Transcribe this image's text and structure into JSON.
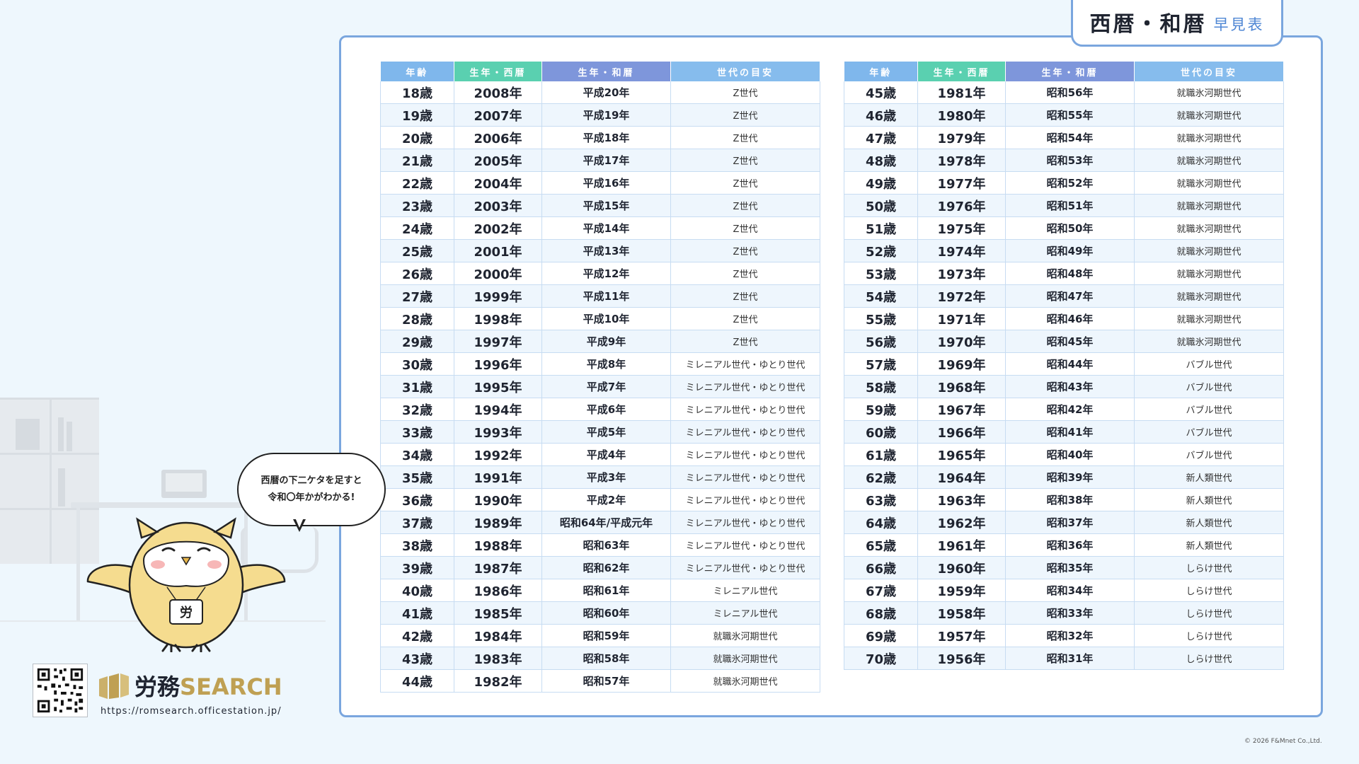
{
  "title": {
    "main": "西暦・和暦",
    "sub": "早見表"
  },
  "headers": [
    "年齢",
    "生年・西暦",
    "生年・和暦",
    "世代の目安"
  ],
  "left_rows": [
    [
      "18歳",
      "2008年",
      "平成20年",
      "Z世代"
    ],
    [
      "19歳",
      "2007年",
      "平成19年",
      "Z世代"
    ],
    [
      "20歳",
      "2006年",
      "平成18年",
      "Z世代"
    ],
    [
      "21歳",
      "2005年",
      "平成17年",
      "Z世代"
    ],
    [
      "22歳",
      "2004年",
      "平成16年",
      "Z世代"
    ],
    [
      "23歳",
      "2003年",
      "平成15年",
      "Z世代"
    ],
    [
      "24歳",
      "2002年",
      "平成14年",
      "Z世代"
    ],
    [
      "25歳",
      "2001年",
      "平成13年",
      "Z世代"
    ],
    [
      "26歳",
      "2000年",
      "平成12年",
      "Z世代"
    ],
    [
      "27歳",
      "1999年",
      "平成11年",
      "Z世代"
    ],
    [
      "28歳",
      "1998年",
      "平成10年",
      "Z世代"
    ],
    [
      "29歳",
      "1997年",
      "平成9年",
      "Z世代"
    ],
    [
      "30歳",
      "1996年",
      "平成8年",
      "ミレニアル世代・ゆとり世代"
    ],
    [
      "31歳",
      "1995年",
      "平成7年",
      "ミレニアル世代・ゆとり世代"
    ],
    [
      "32歳",
      "1994年",
      "平成6年",
      "ミレニアル世代・ゆとり世代"
    ],
    [
      "33歳",
      "1993年",
      "平成5年",
      "ミレニアル世代・ゆとり世代"
    ],
    [
      "34歳",
      "1992年",
      "平成4年",
      "ミレニアル世代・ゆとり世代"
    ],
    [
      "35歳",
      "1991年",
      "平成3年",
      "ミレニアル世代・ゆとり世代"
    ],
    [
      "36歳",
      "1990年",
      "平成2年",
      "ミレニアル世代・ゆとり世代"
    ],
    [
      "37歳",
      "1989年",
      "昭和64年/平成元年",
      "ミレニアル世代・ゆとり世代"
    ],
    [
      "38歳",
      "1988年",
      "昭和63年",
      "ミレニアル世代・ゆとり世代"
    ],
    [
      "39歳",
      "1987年",
      "昭和62年",
      "ミレニアル世代・ゆとり世代"
    ],
    [
      "40歳",
      "1986年",
      "昭和61年",
      "ミレニアル世代"
    ],
    [
      "41歳",
      "1985年",
      "昭和60年",
      "ミレニアル世代"
    ],
    [
      "42歳",
      "1984年",
      "昭和59年",
      "就職氷河期世代"
    ],
    [
      "43歳",
      "1983年",
      "昭和58年",
      "就職氷河期世代"
    ],
    [
      "44歳",
      "1982年",
      "昭和57年",
      "就職氷河期世代"
    ]
  ],
  "right_rows": [
    [
      "45歳",
      "1981年",
      "昭和56年",
      "就職氷河期世代"
    ],
    [
      "46歳",
      "1980年",
      "昭和55年",
      "就職氷河期世代"
    ],
    [
      "47歳",
      "1979年",
      "昭和54年",
      "就職氷河期世代"
    ],
    [
      "48歳",
      "1978年",
      "昭和53年",
      "就職氷河期世代"
    ],
    [
      "49歳",
      "1977年",
      "昭和52年",
      "就職氷河期世代"
    ],
    [
      "50歳",
      "1976年",
      "昭和51年",
      "就職氷河期世代"
    ],
    [
      "51歳",
      "1975年",
      "昭和50年",
      "就職氷河期世代"
    ],
    [
      "52歳",
      "1974年",
      "昭和49年",
      "就職氷河期世代"
    ],
    [
      "53歳",
      "1973年",
      "昭和48年",
      "就職氷河期世代"
    ],
    [
      "54歳",
      "1972年",
      "昭和47年",
      "就職氷河期世代"
    ],
    [
      "55歳",
      "1971年",
      "昭和46年",
      "就職氷河期世代"
    ],
    [
      "56歳",
      "1970年",
      "昭和45年",
      "就職氷河期世代"
    ],
    [
      "57歳",
      "1969年",
      "昭和44年",
      "バブル世代"
    ],
    [
      "58歳",
      "1968年",
      "昭和43年",
      "バブル世代"
    ],
    [
      "59歳",
      "1967年",
      "昭和42年",
      "バブル世代"
    ],
    [
      "60歳",
      "1966年",
      "昭和41年",
      "バブル世代"
    ],
    [
      "61歳",
      "1965年",
      "昭和40年",
      "バブル世代"
    ],
    [
      "62歳",
      "1964年",
      "昭和39年",
      "新人類世代"
    ],
    [
      "63歳",
      "1963年",
      "昭和38年",
      "新人類世代"
    ],
    [
      "64歳",
      "1962年",
      "昭和37年",
      "新人類世代"
    ],
    [
      "65歳",
      "1961年",
      "昭和36年",
      "新人類世代"
    ],
    [
      "66歳",
      "1960年",
      "昭和35年",
      "しらけ世代"
    ],
    [
      "67歳",
      "1959年",
      "昭和34年",
      "しらけ世代"
    ],
    [
      "68歳",
      "1958年",
      "昭和33年",
      "しらけ世代"
    ],
    [
      "69歳",
      "1957年",
      "昭和32年",
      "しらけ世代"
    ],
    [
      "70歳",
      "1956年",
      "昭和31年",
      "しらけ世代"
    ]
  ],
  "bubble": {
    "line1": "西暦の下二ケタを足すと",
    "line2": "令和〇年かがわかる!"
  },
  "mascot": {
    "badge": "労"
  },
  "logo": {
    "name_jp": "労務",
    "name_en": "SEARCH",
    "url": "https://romsearch.officestation.jp/"
  },
  "copyright": "© 2026 F&Mnet Co.,Ltd.",
  "colors": {
    "frame_border": "#7aa6de",
    "header_age": "#7fb7ec",
    "header_western": "#5ad0b0",
    "header_japanese": "#7e96db",
    "header_generation": "#86bced",
    "logo_gold": "#bfa053"
  }
}
